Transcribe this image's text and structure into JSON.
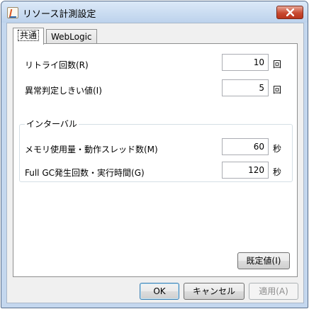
{
  "window": {
    "title": "リソース計測設定",
    "close_icon": "close-icon"
  },
  "tabs": [
    {
      "label": "共通",
      "active": true
    },
    {
      "label": "WebLogic",
      "active": false
    }
  ],
  "fields": {
    "retry": {
      "label": "リトライ回数(R)",
      "value": "10",
      "unit": "回"
    },
    "threshold": {
      "label": "異常判定しきい値(I)",
      "value": "5",
      "unit": "回"
    }
  },
  "interval": {
    "title": "インターバル",
    "memory_thread": {
      "label": "メモリ使用量・動作スレッド数(M)",
      "value": "60",
      "unit": "秒"
    },
    "full_gc": {
      "label": "Full GC発生回数・実行時間(G)",
      "value": "120",
      "unit": "秒"
    }
  },
  "buttons": {
    "default": "既定値(I)",
    "ok": "OK",
    "cancel": "キャンセル",
    "apply": "適用(A)"
  }
}
